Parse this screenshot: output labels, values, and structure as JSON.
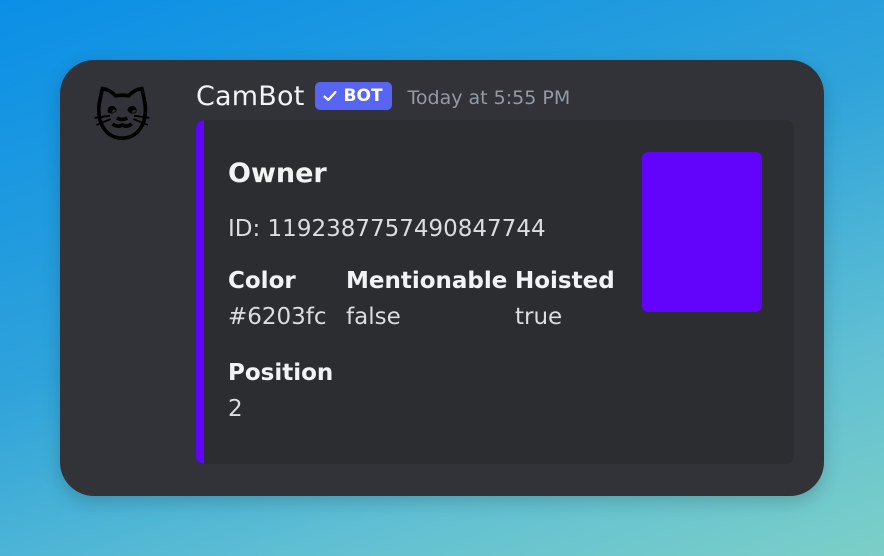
{
  "message": {
    "avatar_emoji": "🐱",
    "username": "CamBot",
    "badge_label": "BOT",
    "timestamp": "Today at 5:55 PM"
  },
  "embed": {
    "accent_color": "#6203fc",
    "title": "Owner",
    "description": "ID: 1192387757490847744",
    "fields": [
      {
        "name": "Color",
        "value": "#6203fc"
      },
      {
        "name": "Mentionable",
        "value": "false"
      },
      {
        "name": "Hoisted",
        "value": "true"
      },
      {
        "name": "Position",
        "value": "2"
      }
    ],
    "thumbnail_color": "#6203fc"
  },
  "icons": {
    "badge_icon": "checkmark-icon",
    "avatar_icon": "cat-face-icon"
  }
}
